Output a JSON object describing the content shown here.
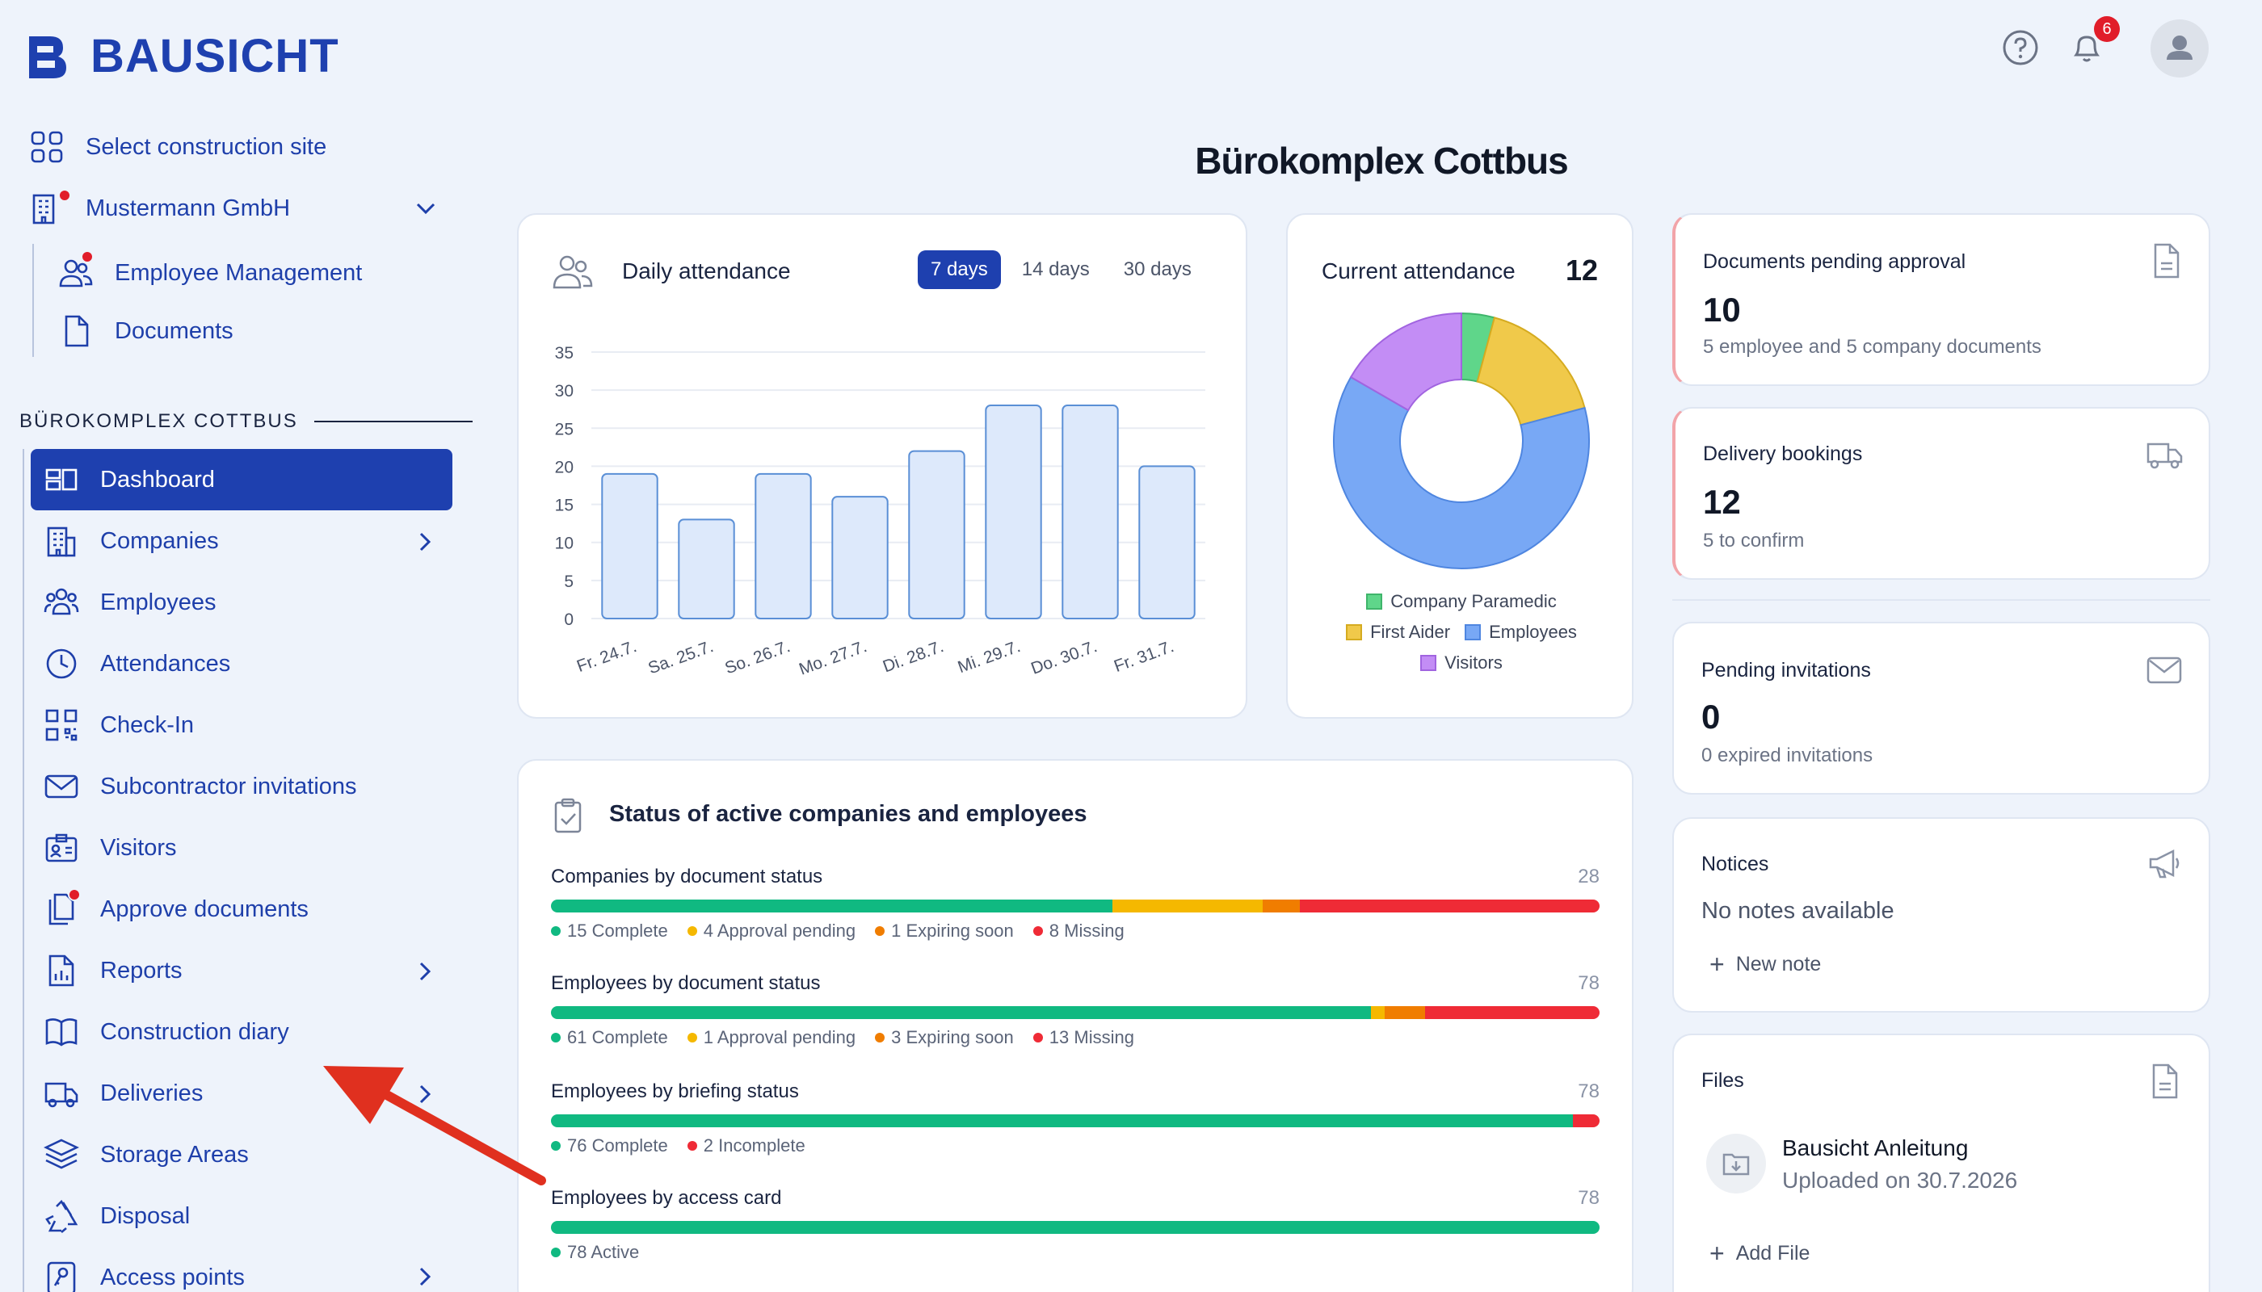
{
  "brand": {
    "name": "BAUSICHT"
  },
  "header": {
    "notifications_count": "6",
    "page_title": "Bürokomplex Cottbus"
  },
  "sidebar": {
    "top": [
      {
        "label": "Select construction site",
        "icon": "grid-icon"
      },
      {
        "label": "Mustermann GmbH",
        "icon": "building-icon"
      },
      {
        "label": "Employee Management",
        "icon": "users-icon"
      },
      {
        "label": "Documents",
        "icon": "document-icon"
      }
    ],
    "section_label": "BÜROKOMPLEX COTTBUS",
    "nav": [
      {
        "label": "Dashboard",
        "icon": "dashboard-icon"
      },
      {
        "label": "Companies",
        "icon": "building-icon"
      },
      {
        "label": "Employees",
        "icon": "users-icon"
      },
      {
        "label": "Attendances",
        "icon": "clock-icon"
      },
      {
        "label": "Check-In",
        "icon": "qr-icon"
      },
      {
        "label": "Subcontractor invitations",
        "icon": "mail-icon"
      },
      {
        "label": "Visitors",
        "icon": "id-card-icon"
      },
      {
        "label": "Approve documents",
        "icon": "documents-icon"
      },
      {
        "label": "Reports",
        "icon": "report-icon"
      },
      {
        "label": "Construction diary",
        "icon": "book-icon"
      },
      {
        "label": "Deliveries",
        "icon": "truck-icon"
      },
      {
        "label": "Storage Areas",
        "icon": "layers-icon"
      },
      {
        "label": "Disposal",
        "icon": "recycle-icon"
      },
      {
        "label": "Access points",
        "icon": "key-icon"
      }
    ]
  },
  "attendance": {
    "title": "Daily attendance",
    "tabs": [
      "7 days",
      "14 days",
      "30 days"
    ],
    "active_tab": "7 days"
  },
  "current_attendance": {
    "title": "Current attendance",
    "count": "12",
    "legend": [
      "Company Paramedic",
      "First Aider",
      "Employees",
      "Visitors"
    ]
  },
  "status": {
    "title": "Status of active companies and employees",
    "rows": [
      {
        "label": "Companies by document status",
        "total": "28",
        "items": [
          {
            "text": "15 Complete",
            "value": 15,
            "color": "#10b981"
          },
          {
            "text": "4 Approval pending",
            "value": 4,
            "color": "#f5b800"
          },
          {
            "text": "1 Expiring soon",
            "value": 1,
            "color": "#f07d00"
          },
          {
            "text": "8 Missing",
            "value": 8,
            "color": "#ef2b36"
          }
        ]
      },
      {
        "label": "Employees by document status",
        "total": "78",
        "items": [
          {
            "text": "61 Complete",
            "value": 61,
            "color": "#10b981"
          },
          {
            "text": "1 Approval pending",
            "value": 1,
            "color": "#f5b800"
          },
          {
            "text": "3 Expiring soon",
            "value": 3,
            "color": "#f07d00"
          },
          {
            "text": "13 Missing",
            "value": 13,
            "color": "#ef2b36"
          }
        ]
      },
      {
        "label": "Employees by briefing status",
        "total": "78",
        "items": [
          {
            "text": "76 Complete",
            "value": 76,
            "color": "#10b981"
          },
          {
            "text": "2 Incomplete",
            "value": 2,
            "color": "#ef2b36"
          }
        ]
      },
      {
        "label": "Employees by access card",
        "total": "78",
        "items": [
          {
            "text": "78 Active",
            "value": 78,
            "color": "#10b981"
          }
        ]
      }
    ]
  },
  "cards": {
    "docs": {
      "title": "Documents pending approval",
      "value": "10",
      "sub": "5 employee and 5 company documents"
    },
    "delivery": {
      "title": "Delivery bookings",
      "value": "12",
      "sub": "5 to confirm"
    },
    "invites": {
      "title": "Pending invitations",
      "value": "0",
      "sub": "0 expired invitations"
    },
    "notices": {
      "title": "Notices",
      "empty": "No notes available",
      "action": "New note"
    },
    "files": {
      "title": "Files",
      "file_name": "Bausicht Anleitung",
      "file_date": "Uploaded on 30.7.2026",
      "action": "Add File"
    }
  },
  "chart_data": [
    {
      "type": "bar",
      "categories": [
        "Fr. 24.7.",
        "Sa. 25.7.",
        "So. 26.7.",
        "Mo. 27.7.",
        "Di. 28.7.",
        "Mi. 29.7.",
        "Do. 30.7.",
        "Fr. 31.7."
      ],
      "values": [
        19,
        13,
        19,
        16,
        22,
        28,
        28,
        20
      ],
      "ylim": [
        0,
        35
      ],
      "yticks": [
        0,
        5,
        10,
        15,
        20,
        25,
        30,
        35
      ],
      "grid": true,
      "colors": {
        "fill": "#dde9fb",
        "stroke": "#5a8fd6"
      }
    },
    {
      "type": "pie",
      "labels": [
        "Company Paramedic",
        "First Aider",
        "Employees",
        "Visitors"
      ],
      "values": [
        0.5,
        2,
        7.5,
        2
      ],
      "colors": [
        "#5fd68a",
        "#f0c94a",
        "#78a8f5",
        "#c38df5"
      ],
      "legend": "bottom"
    }
  ]
}
